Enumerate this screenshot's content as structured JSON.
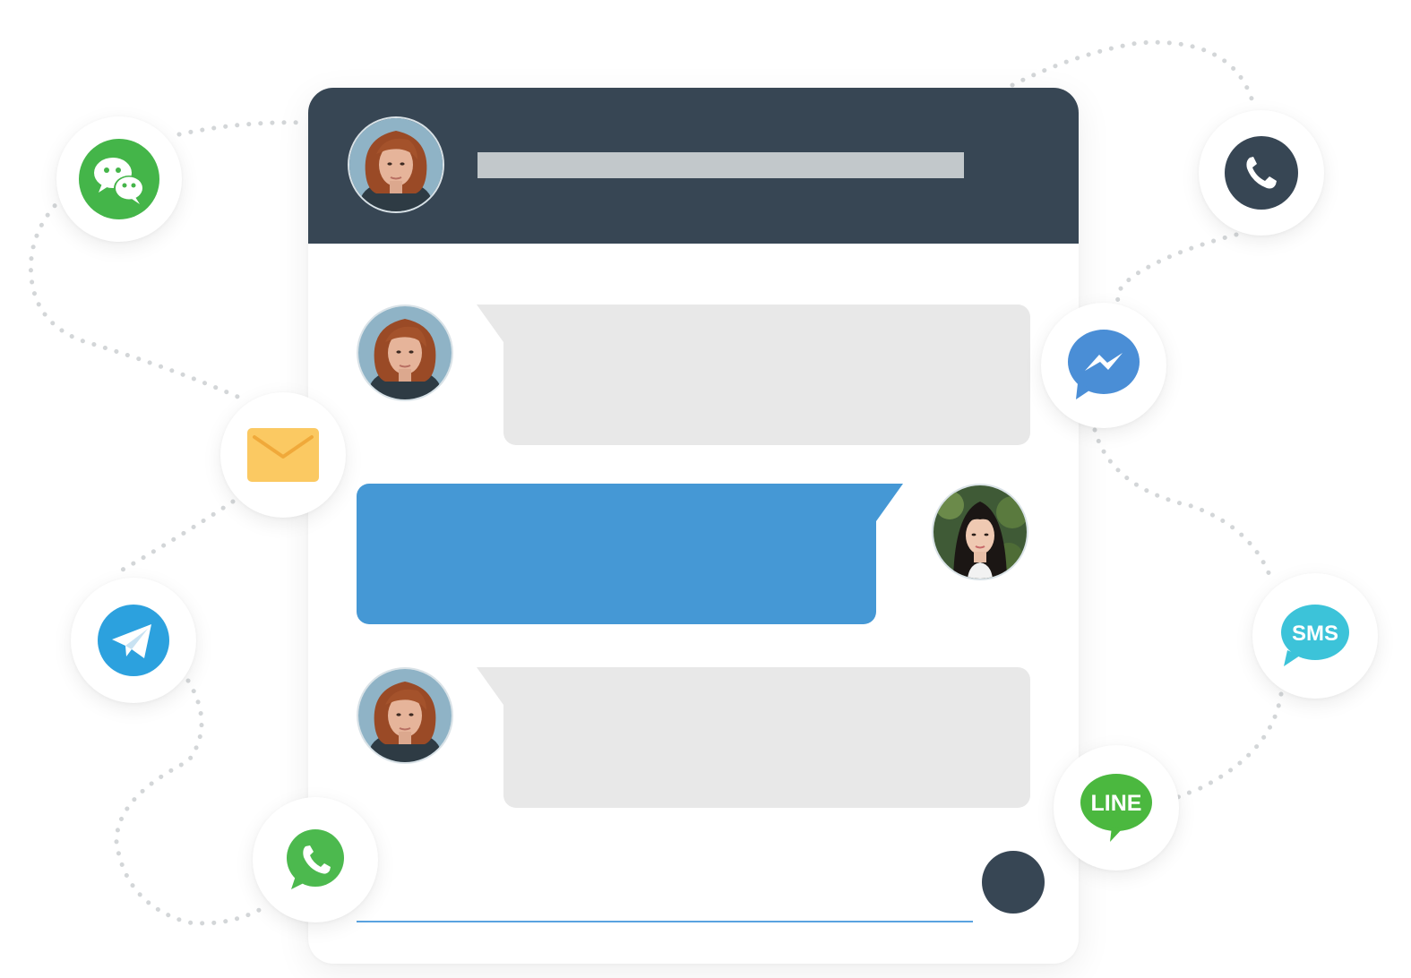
{
  "channels": [
    {
      "name": "wechat",
      "color": "#44b549"
    },
    {
      "name": "email",
      "color": "#fbc962"
    },
    {
      "name": "telegram",
      "color": "#2ca1de"
    },
    {
      "name": "whatsapp",
      "color": "#4cb94e"
    },
    {
      "name": "phone",
      "color": "#374654"
    },
    {
      "name": "messenger",
      "color": "#4a8ed6"
    },
    {
      "name": "sms",
      "label": "SMS",
      "color": "#3cc3d9"
    },
    {
      "name": "line",
      "label": "LINE",
      "color": "#4bb83f"
    }
  ],
  "chat": {
    "header_color": "#374654",
    "incoming_bubble_color": "#e8e8e8",
    "outgoing_bubble_color": "#4598d5",
    "send_button_color": "#374654",
    "composer_line_color": "#5aa3e0"
  }
}
